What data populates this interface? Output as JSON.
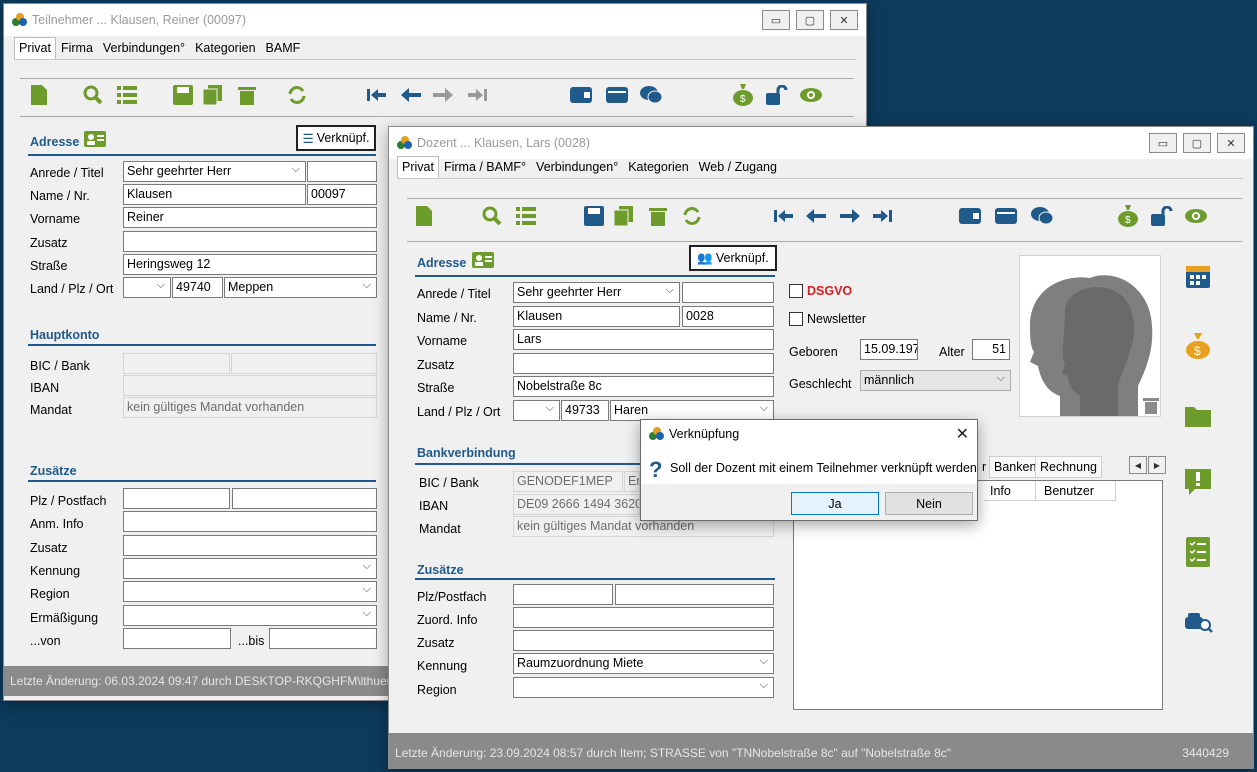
{
  "win1": {
    "title": "Teilnehmer ... Klausen, Reiner (00097)",
    "tabs": [
      "Privat",
      "Firma",
      "Verbindungen°",
      "Kategorien",
      "BAMF"
    ],
    "adresse_title": "Adresse",
    "verknuepf_label": "Verknüpf.",
    "labels": {
      "anrede": "Anrede / Titel",
      "name": "Name / Nr.",
      "vorname": "Vorname",
      "zusatz": "Zusatz",
      "strasse": "Straße",
      "land": "Land / Plz / Ort"
    },
    "values": {
      "anrede": "Sehr geehrter Herr",
      "titel": "",
      "name": "Klausen",
      "nr": "00097",
      "vorname": "Reiner",
      "zusatz": "",
      "strasse": "Heringsweg 12",
      "land": "",
      "plz": "49740",
      "ort": "Meppen"
    },
    "hauptkonto_title": "Hauptkonto",
    "hk_labels": {
      "bic": "BIC / Bank",
      "iban": "IBAN",
      "mandat": "Mandat"
    },
    "hk_values": {
      "bic": "",
      "bank": "",
      "iban": "",
      "mandat": "kein gültiges Mandat vorhanden"
    },
    "zusaetze_title": "Zusätze",
    "z_labels": {
      "plz": "Plz / Postfach",
      "anm": "Anm. Info",
      "zusatz": "Zusatz",
      "kennung": "Kennung",
      "region": "Region",
      "ermaessigung": "Ermäßigung",
      "von": "...von",
      "bis": "...bis"
    },
    "z_values": {
      "plz": "",
      "postfach": "",
      "anm": "",
      "zusatz": "",
      "kennung": "",
      "region": "",
      "ermaessigung": "",
      "von": "",
      "bis": ""
    },
    "status": "Letzte Änderung: 06.03.2024 09:47 durch DESKTOP-RKQGHFM\\lthuen"
  },
  "win2": {
    "title": "Dozent ... Klausen, Lars (0028)",
    "tabs": [
      "Privat",
      "Firma / BAMF°",
      "Verbindungen°",
      "Kategorien",
      "Web / Zugang"
    ],
    "adresse_title": "Adresse",
    "verknuepf_label": "Verknüpf.",
    "labels": {
      "anrede": "Anrede / Titel",
      "name": "Name / Nr.",
      "vorname": "Vorname",
      "zusatz": "Zusatz",
      "strasse": "Straße",
      "land": "Land / Plz / Ort"
    },
    "values": {
      "anrede": "Sehr geehrter Herr",
      "titel": "",
      "name": "Klausen",
      "nr": "0028",
      "vorname": "Lars",
      "zusatz": "",
      "strasse": "Nobelstraße 8c",
      "land": "",
      "plz": "49733",
      "ort": "Haren"
    },
    "dsgvo_label": "DSGVO",
    "newsletter_label": "Newsletter",
    "geboren_label": "Geboren",
    "geboren_value": "15.09.197",
    "alter_label": "Alter",
    "alter_value": "51",
    "geschlecht_label": "Geschlecht",
    "geschlecht_value": "männlich",
    "bank_title": "Bankverbindung",
    "bk_labels": {
      "bic": "BIC / Bank",
      "iban": "IBAN",
      "mandat": "Mandat"
    },
    "bk_values": {
      "bic": "GENODEF1MEP",
      "bank": "Em",
      "iban": "DE09 2666 1494 3620 2",
      "mandat": "kein gültiges Mandat vorhanden"
    },
    "zusaetze_title": "Zusätze",
    "z_labels": {
      "plz": "Plz/Postfach",
      "zuord": "Zuord. Info",
      "zusatz": "Zusatz",
      "kennung": "Kennung",
      "region": "Region"
    },
    "z_values": {
      "plz": "",
      "postfach": "",
      "zuord": "",
      "zusatz": "",
      "kennung": "Raumzuordnung Miete",
      "region": ""
    },
    "right_tabs": [
      "r",
      "Banken",
      "Rechnung"
    ],
    "grid_headers": [
      "Info",
      "Benutzer"
    ],
    "status": "Letzte Änderung: 23.09.2024 08:57 durch Item; STRASSE von \"TNNobelstraße 8c\" auf \"Nobelstraße 8c\"",
    "status_id": "3440429"
  },
  "dialog": {
    "title": "Verknüpfung",
    "message": "Soll der Dozent mit einem Teilnehmer verknüpft werden?",
    "yes": "Ja",
    "no": "Nein"
  },
  "colors": {
    "green": "#6e9c2c",
    "blue": "#1f5a8a",
    "orange": "#e8a020",
    "red": "#d62020"
  }
}
